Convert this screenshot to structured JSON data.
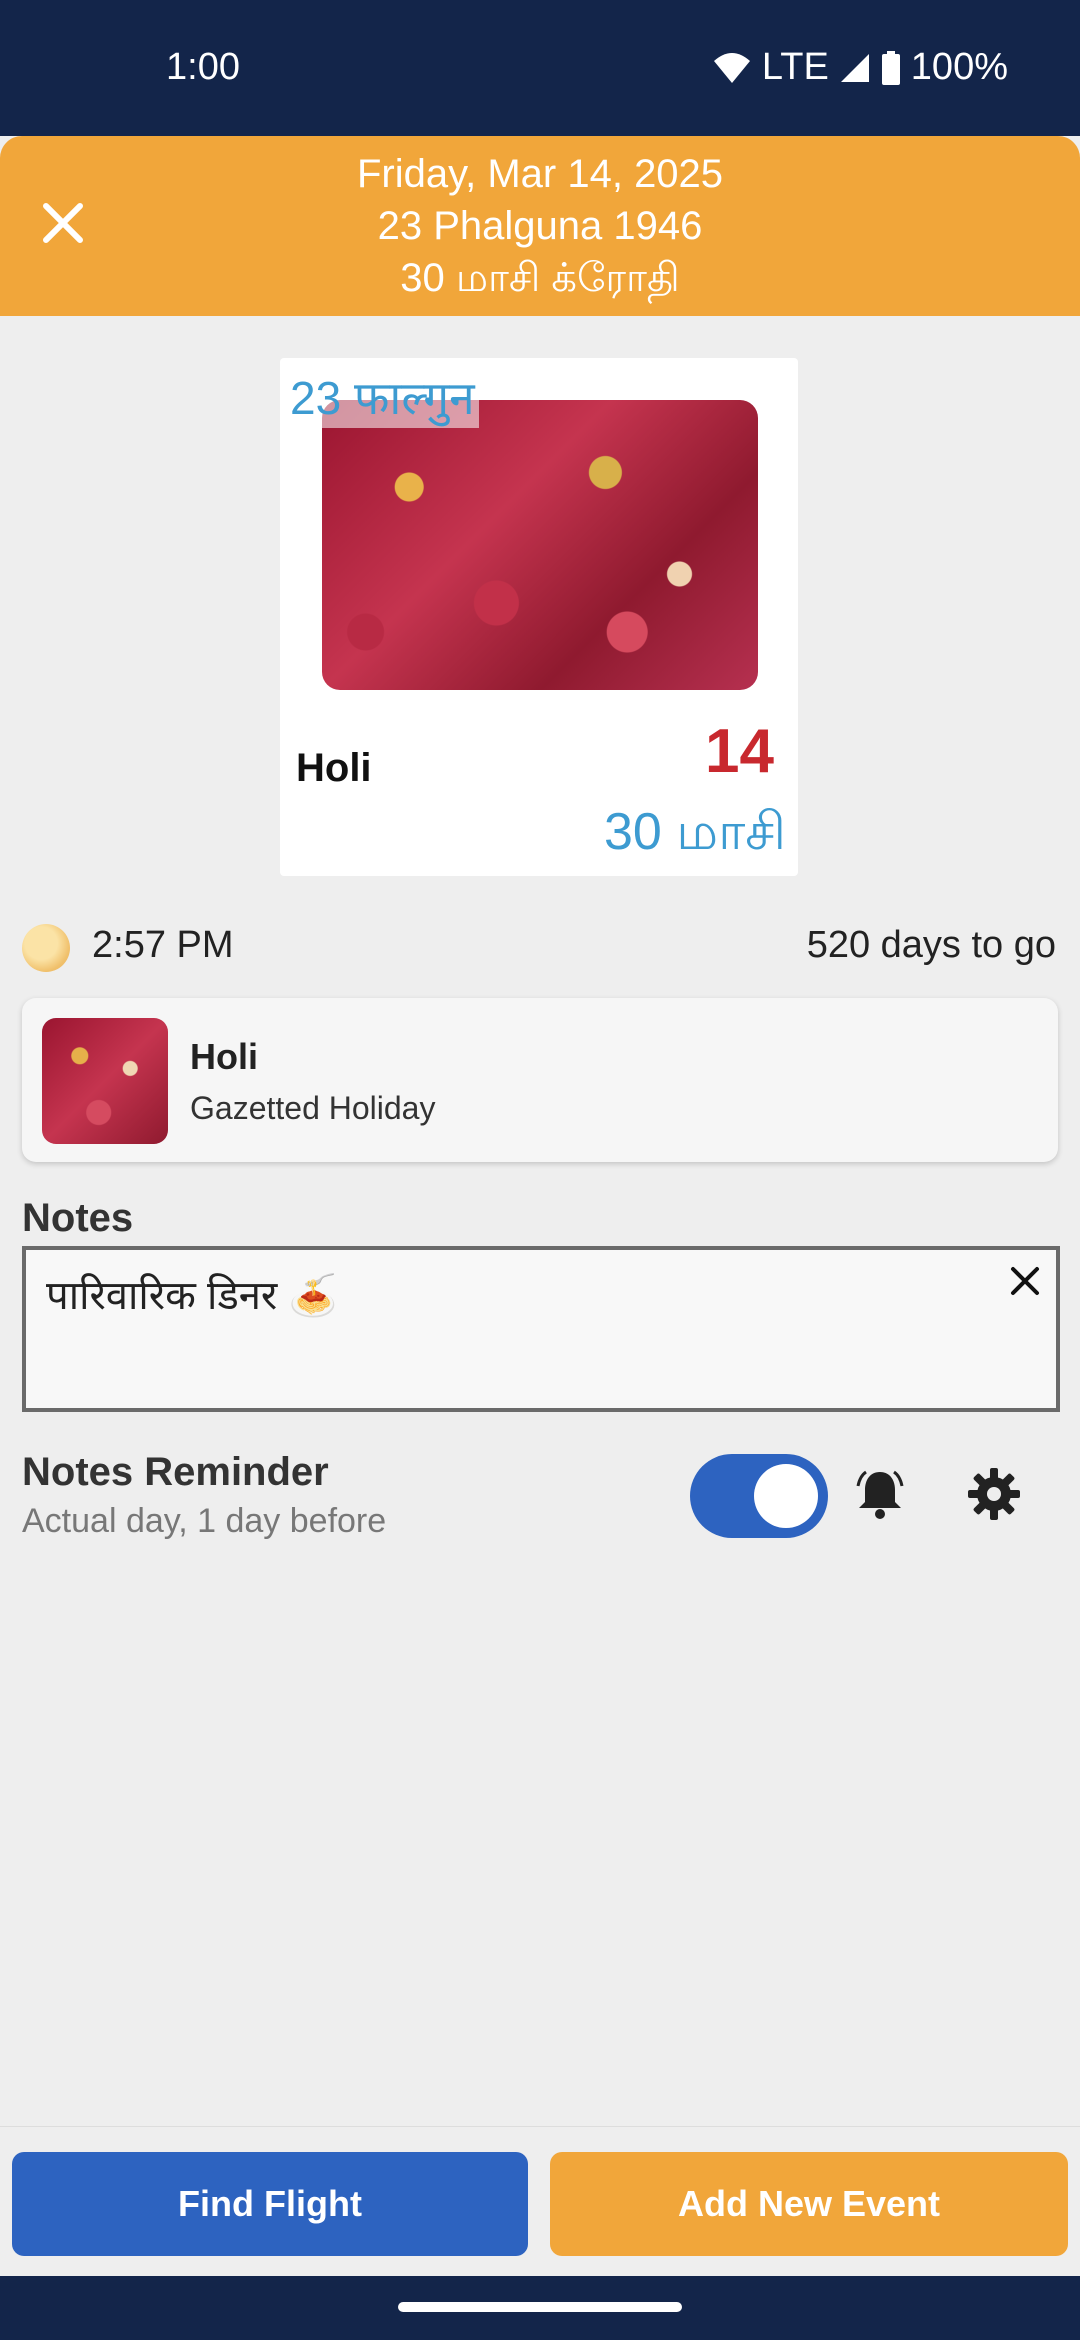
{
  "status_bar": {
    "time": "1:00",
    "network": "LTE",
    "battery": "100%"
  },
  "header": {
    "line1": "Friday, Mar 14, 2025",
    "line2": "23 Phalguna 1946",
    "line3": "30 மாசி க்ரோதி",
    "background_color": "#f1a63a"
  },
  "day_card": {
    "hindi_date": "23 फाल्गुन",
    "event_name": "Holi",
    "day_number": "14",
    "tamil_date": "30 மாசி"
  },
  "info_row": {
    "moon_time": "2:57 PM",
    "days_to_go": "520 days to go"
  },
  "holiday": {
    "title": "Holi",
    "type": "Gazetted Holiday"
  },
  "notes": {
    "label": "Notes",
    "value": "पारिवारिक डिनर  🍝"
  },
  "reminder": {
    "title": "Notes Reminder",
    "subtitle": "Actual day, 1 day before",
    "enabled": true
  },
  "buttons": {
    "find_flight": "Find Flight",
    "add_event": "Add New Event"
  },
  "colors": {
    "primary_blue": "#2d63c0",
    "accent_orange": "#f1a63a",
    "day_number_red": "#c8282e",
    "date_blue": "#3d9bd1"
  }
}
